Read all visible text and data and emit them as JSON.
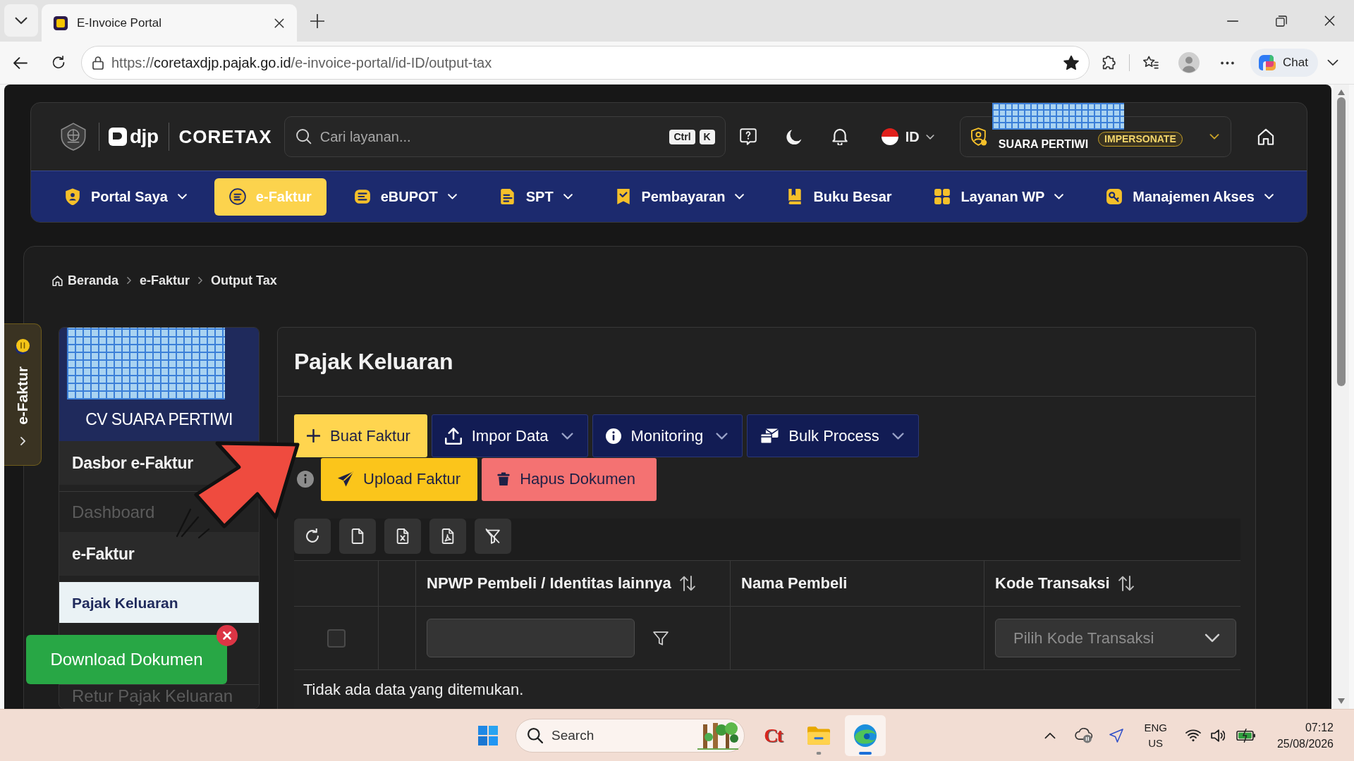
{
  "browser": {
    "tab": {
      "title": "E-Invoice Portal"
    },
    "address": {
      "scheme": "https://",
      "host": "coretaxdjp.pajak.go.id",
      "path": "/e-invoice-portal/id-ID/output-tax",
      "bookmarked": true
    },
    "chat": "Chat"
  },
  "header": {
    "logos": [
      "djp",
      "CORETAX"
    ],
    "search": {
      "placeholder": "Cari layanan...",
      "shortcut": [
        "Ctrl",
        "K"
      ]
    },
    "language": "ID",
    "user": {
      "name": "SUARA PERTIWI",
      "badge": "IMPERSONATE"
    },
    "nav": [
      {
        "label": "Portal Saya",
        "selected": false,
        "dropdown": true
      },
      {
        "label": "e-Faktur",
        "selected": true,
        "dropdown": false
      },
      {
        "label": "eBUPOT",
        "selected": false,
        "dropdown": true
      },
      {
        "label": "SPT",
        "selected": false,
        "dropdown": true
      },
      {
        "label": "Pembayaran",
        "selected": false,
        "dropdown": true
      },
      {
        "label": "Buku Besar",
        "selected": false,
        "dropdown": false
      },
      {
        "label": "Layanan WP",
        "selected": false,
        "dropdown": true
      },
      {
        "label": "Manajemen Akses",
        "selected": false,
        "dropdown": true
      }
    ]
  },
  "side_tab": {
    "label": "e-Faktur"
  },
  "breadcrumb": [
    "Beranda",
    "e-Faktur",
    "Output Tax"
  ],
  "sidebar": {
    "company": "CV SUARA PERTIWI",
    "groups": [
      {
        "label": "Dasbor e-Faktur",
        "children": [
          {
            "label": "Dashboard",
            "selected": false,
            "disabled": true
          }
        ]
      },
      {
        "label": "e-Faktur",
        "children": [
          {
            "label": "Pajak Keluaran",
            "selected": true,
            "disabled": false
          },
          {
            "label": "Retur Pajak Keluaran",
            "selected": false,
            "disabled": true
          }
        ]
      }
    ]
  },
  "panel": {
    "title": "Pajak Keluaran",
    "actions": [
      {
        "label": "Buat Faktur",
        "kind": "primary",
        "dropdown": false
      },
      {
        "label": "Impor Data",
        "kind": "dark",
        "dropdown": true
      },
      {
        "label": "Monitoring",
        "kind": "dark",
        "dropdown": true
      },
      {
        "label": "Bulk Process",
        "kind": "dark",
        "dropdown": true
      }
    ],
    "secondary_actions": [
      {
        "label": "Upload Faktur",
        "kind": "warning"
      },
      {
        "label": "Hapus Dokumen",
        "kind": "danger"
      }
    ],
    "table": {
      "select_all": {
        "checked": false
      },
      "columns": [
        {
          "label": "NPWP Pembeli / Identitas lainnya",
          "sortable": true,
          "kind": "text-filter"
        },
        {
          "label": "Nama Pembeli",
          "sortable": false,
          "kind": "plain"
        },
        {
          "label": "Kode Transaksi",
          "sortable": true,
          "kind": "select-filter",
          "placeholder": "Pilih Kode Transaksi"
        }
      ],
      "empty_message": "Tidak ada data yang ditemukan."
    }
  },
  "toast": {
    "label": "Download Dokumen"
  },
  "taskbar": {
    "search": {
      "placeholder": "Search"
    },
    "apps": [
      {
        "kind": "logo",
        "text": "Ct",
        "running": false,
        "selected": false
      },
      {
        "kind": "folder",
        "running": true,
        "selected": false
      },
      {
        "kind": "browser",
        "running": true,
        "selected": true
      }
    ],
    "language": [
      "ENG",
      "US"
    ],
    "time": "07:12",
    "date": "25/08/2026"
  }
}
